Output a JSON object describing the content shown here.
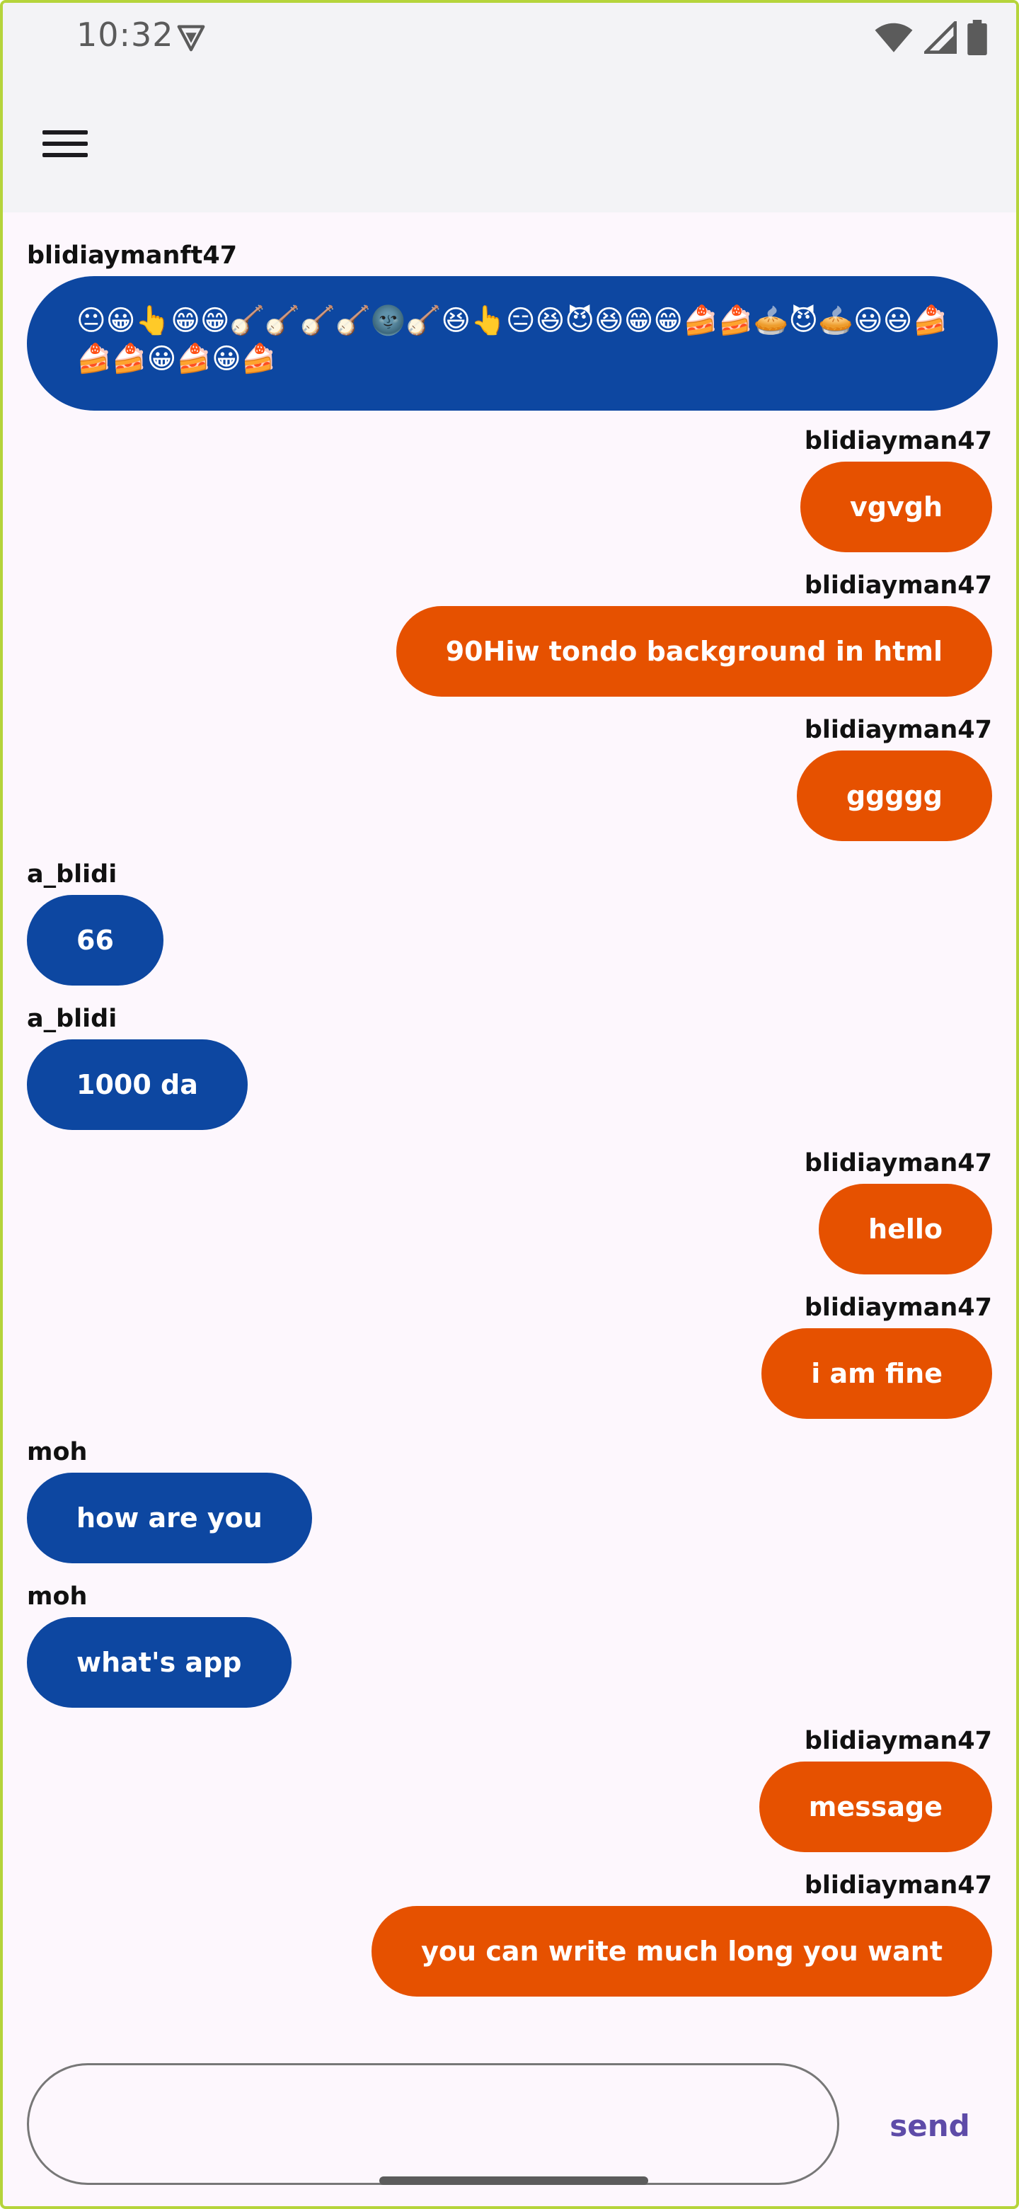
{
  "status": {
    "time": "10:32",
    "icons": [
      "vpn-icon",
      "wifi-icon",
      "cellular-signal-icon",
      "battery-icon"
    ]
  },
  "appbar": {
    "menu_icon": "hamburger-menu-icon"
  },
  "colors": {
    "incoming_bubble": "#0D47A1",
    "outgoing_bubble": "#E65100",
    "send_text": "#5E4BA8",
    "background": "#FDF7FD"
  },
  "messages": [
    {
      "sender": "blidiaymanft47",
      "text": "😐😀👆😁😁🪕🪕🪕🪕🌚🪕😆👆😑😆😈😆😁😁🍰🍰🥧😈🥧😃😃🍰🍰🍰😀🍰😀🍰",
      "side": "left"
    },
    {
      "sender": "blidiayman47",
      "text": "vgvgh",
      "side": "right"
    },
    {
      "sender": "blidiayman47",
      "text": "90Hiw tondo background in html",
      "side": "right"
    },
    {
      "sender": "blidiayman47",
      "text": "ggggg",
      "side": "right"
    },
    {
      "sender": "a_blidi",
      "text": "66",
      "side": "left"
    },
    {
      "sender": "a_blidi",
      "text": "1000 da",
      "side": "left"
    },
    {
      "sender": "blidiayman47",
      "text": "hello",
      "side": "right"
    },
    {
      "sender": "blidiayman47",
      "text": "i am fine",
      "side": "right"
    },
    {
      "sender": "moh",
      "text": "how are you",
      "side": "left"
    },
    {
      "sender": "moh",
      "text": "what's app",
      "side": "left"
    },
    {
      "sender": "blidiayman47",
      "text": "message",
      "side": "right"
    },
    {
      "sender": "blidiayman47",
      "text": "you can write much long you want",
      "side": "right"
    }
  ],
  "composer": {
    "value": "",
    "placeholder": "",
    "send_label": "send"
  }
}
